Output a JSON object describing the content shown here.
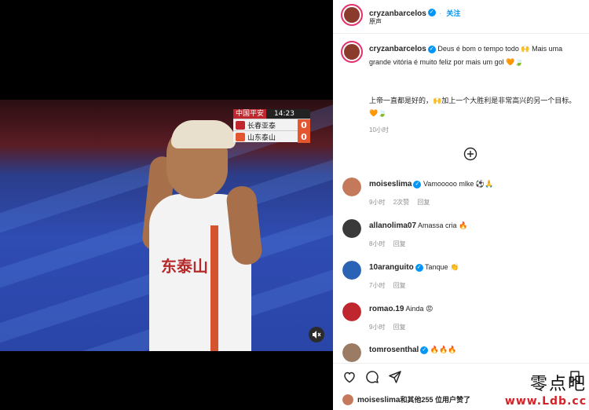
{
  "video": {
    "scoreboard": {
      "league": "中国平安",
      "time": "14:23",
      "teams": [
        {
          "name": "长春亚泰",
          "score": "0"
        },
        {
          "name": "山东泰山",
          "score": "0"
        }
      ]
    },
    "jersey_text": "东泰山",
    "mute_icon": "muted-speaker-icon"
  },
  "header": {
    "username": "cryzanbarcelos",
    "follow_label": "关注",
    "subtitle": "原声"
  },
  "caption": {
    "username": "cryzanbarcelos",
    "text": "Deus é bom o tempo todo 🙌 Mais uma grande vitória é muito feliz por mais um gol 🧡🍃",
    "translation": "上帝一直都是好的，🙌加上一个大胜利是非常高兴的另一个目标。 🧡🍃",
    "time": "10小时"
  },
  "load_more_icon": "plus-circle-icon",
  "comments": [
    {
      "username": "moiseslima",
      "verified": true,
      "text": "Vamooooo mlke ⚽🙏",
      "time": "9小时",
      "likes": "2次赞",
      "reply": "回复",
      "avatar_color": "#c47a5a"
    },
    {
      "username": "allanolima07",
      "verified": false,
      "text": "Amassa cria 🔥",
      "time": "8小时",
      "likes": "",
      "reply": "回复",
      "avatar_color": "#3a3a3a"
    },
    {
      "username": "10aranguito",
      "verified": true,
      "text": "Tanque 👏",
      "time": "7小时",
      "likes": "",
      "reply": "回复",
      "avatar_color": "#2a62b5"
    },
    {
      "username": "romao.19",
      "verified": false,
      "text": "Ainda 😡",
      "time": "9小时",
      "likes": "",
      "reply": "回复",
      "avatar_color": "#c0262d"
    },
    {
      "username": "tomrosenthal",
      "verified": true,
      "text": "🔥🔥🔥",
      "time": "",
      "likes": "",
      "reply": "",
      "avatar_color": "#9b7b63"
    }
  ],
  "actions": {
    "like_icon": "heart-icon",
    "comment_icon": "comment-icon",
    "share_icon": "send-icon",
    "save_icon": "bookmark-icon"
  },
  "likes_summary": {
    "username": "moiseslima",
    "text": "和其他255 位用户赞了"
  },
  "watermark": {
    "cn": "零点吧",
    "url": "www.Ldb.cc"
  },
  "colors": {
    "accent": "#0095f6",
    "story_ring": "#e1306c",
    "watermark_red": "#d2232a"
  }
}
